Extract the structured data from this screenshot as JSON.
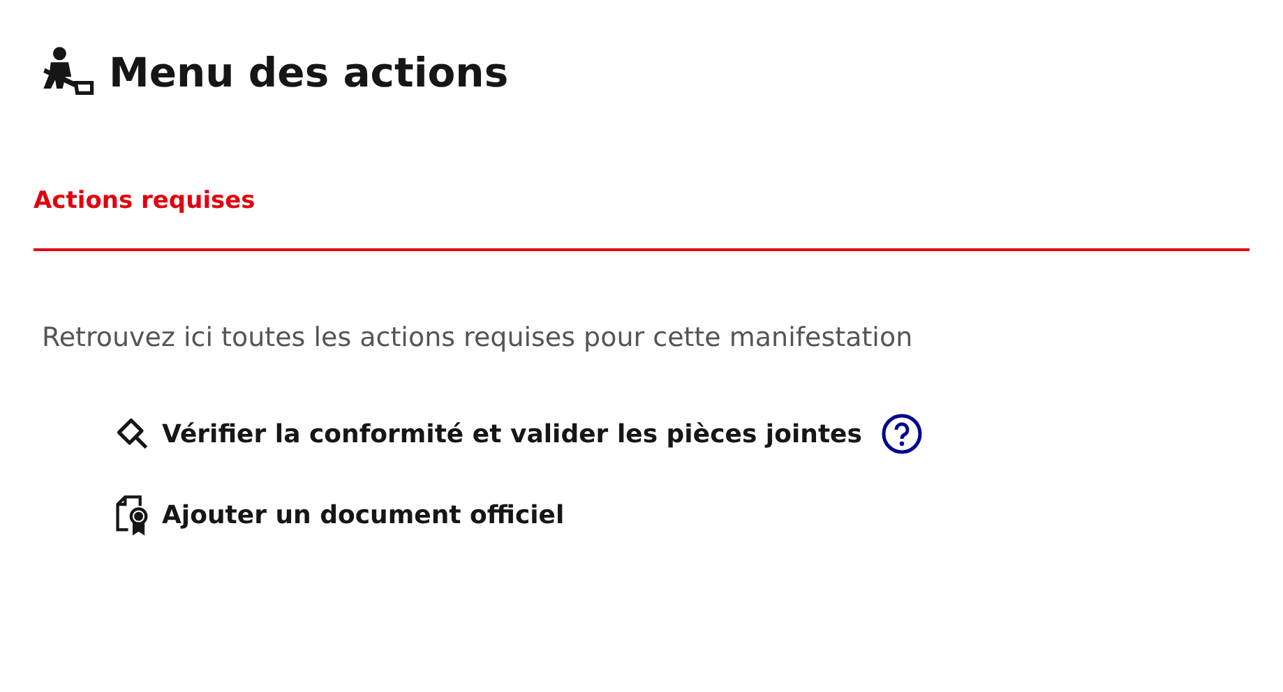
{
  "title": "Menu des actions",
  "tabs": [
    {
      "label": "Actions requises",
      "selected": true
    }
  ],
  "description": "Retrouvez ici toutes les actions requises pour cette manifestation",
  "actions": [
    {
      "kind": "verify",
      "label": "Vérifier la conformité et valider les pièces jointes",
      "help": true
    },
    {
      "kind": "document",
      "label": "Ajouter un document officiel",
      "help": false
    }
  ]
}
